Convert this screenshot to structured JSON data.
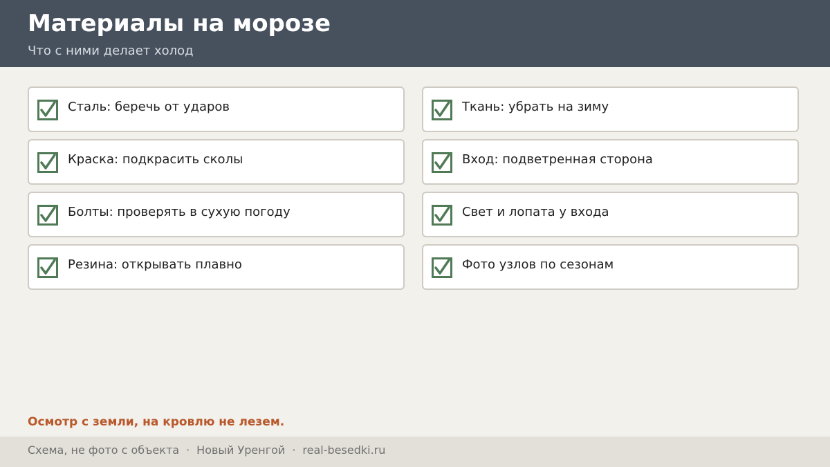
{
  "header": {
    "title": "Материалы на морозе",
    "subtitle": "Что с ними делает холод"
  },
  "colors": {
    "header_bg": "#47515e",
    "check": "#4f7a55",
    "note": "#b8582b"
  },
  "checklist": {
    "left": [
      {
        "label": "Сталь: беречь от ударов",
        "checked": true,
        "icon": "checkbox-checked-icon"
      },
      {
        "label": "Краска: подкрасить сколы",
        "checked": true,
        "icon": "checkbox-checked-icon"
      },
      {
        "label": "Болты: проверять в сухую погоду",
        "checked": true,
        "icon": "checkbox-checked-icon"
      },
      {
        "label": "Резина: открывать плавно",
        "checked": true,
        "icon": "checkbox-checked-icon"
      }
    ],
    "right": [
      {
        "label": "Ткань: убрать на зиму",
        "checked": true,
        "icon": "checkbox-checked-icon"
      },
      {
        "label": "Вход: подветренная сторона",
        "checked": true,
        "icon": "checkbox-checked-icon"
      },
      {
        "label": "Свет и лопата у входа",
        "checked": true,
        "icon": "checkbox-checked-icon"
      },
      {
        "label": "Фото узлов по сезонам",
        "checked": true,
        "icon": "checkbox-checked-icon"
      }
    ]
  },
  "note": "Осмотр с земли, на кровлю не лезем.",
  "footer": {
    "items": [
      "Схема, не фото с объекта",
      "Новый Уренгой",
      "real-besedki.ru"
    ],
    "separator": "·"
  }
}
